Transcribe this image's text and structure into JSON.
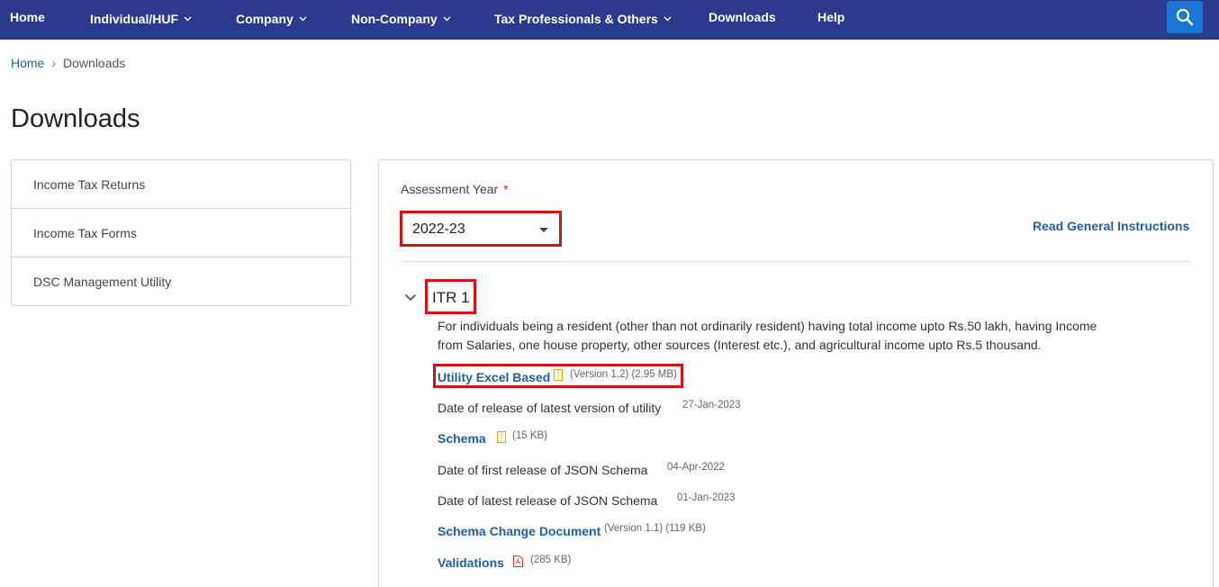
{
  "nav": {
    "items": [
      {
        "label": "Home"
      },
      {
        "label": "Individual/HUF"
      },
      {
        "label": "Company"
      },
      {
        "label": "Non-Company"
      },
      {
        "label": "Tax Professionals & Others"
      },
      {
        "label": "Downloads"
      },
      {
        "label": "Help"
      }
    ],
    "search_icon": "search-icon"
  },
  "breadcrumb": {
    "home": "Home",
    "separator": "›",
    "current": "Downloads"
  },
  "page": {
    "title": "Downloads"
  },
  "sidebar": {
    "items": [
      {
        "label": "Income Tax Returns"
      },
      {
        "label": "Income Tax Forms"
      },
      {
        "label": "DSC Management Utility"
      }
    ]
  },
  "main": {
    "assessment_year_label": "Assessment Year",
    "required_mark": "*",
    "assessment_year_value": "2022-23",
    "read_instructions": "Read General Instructions",
    "section": {
      "title": "ITR 1",
      "description": "For individuals being a resident (other than not ordinarily resident) having total income upto Rs.50 lakh, having Income from Salaries, one house property, other sources (Interest etc.), and agricultural income upto Rs.5 thousand.",
      "utility_link": "Utility Excel Based",
      "utility_meta": "(Version 1.2) (2.95 MB)",
      "release_label": "Date of release of latest version of utility",
      "release_date": "27-Jan-2023",
      "schema_link": "Schema",
      "schema_meta": "(15 KB)",
      "first_json_label": "Date of first release of JSON Schema",
      "first_json_date": "04-Apr-2022",
      "latest_json_label": "Date of latest release of JSON Schema",
      "latest_json_date": "01-Jan-2023",
      "change_doc_link": "Schema Change Document",
      "change_doc_meta": "(Version 1.1) (119 KB)",
      "validations_link": "Validations",
      "validations_meta": "(285 KB)"
    }
  },
  "colors": {
    "nav_bg": "#2a3a8c",
    "search_bg": "#1976d2",
    "link": "#1f5fa5",
    "highlight_border": "#d0121b"
  }
}
